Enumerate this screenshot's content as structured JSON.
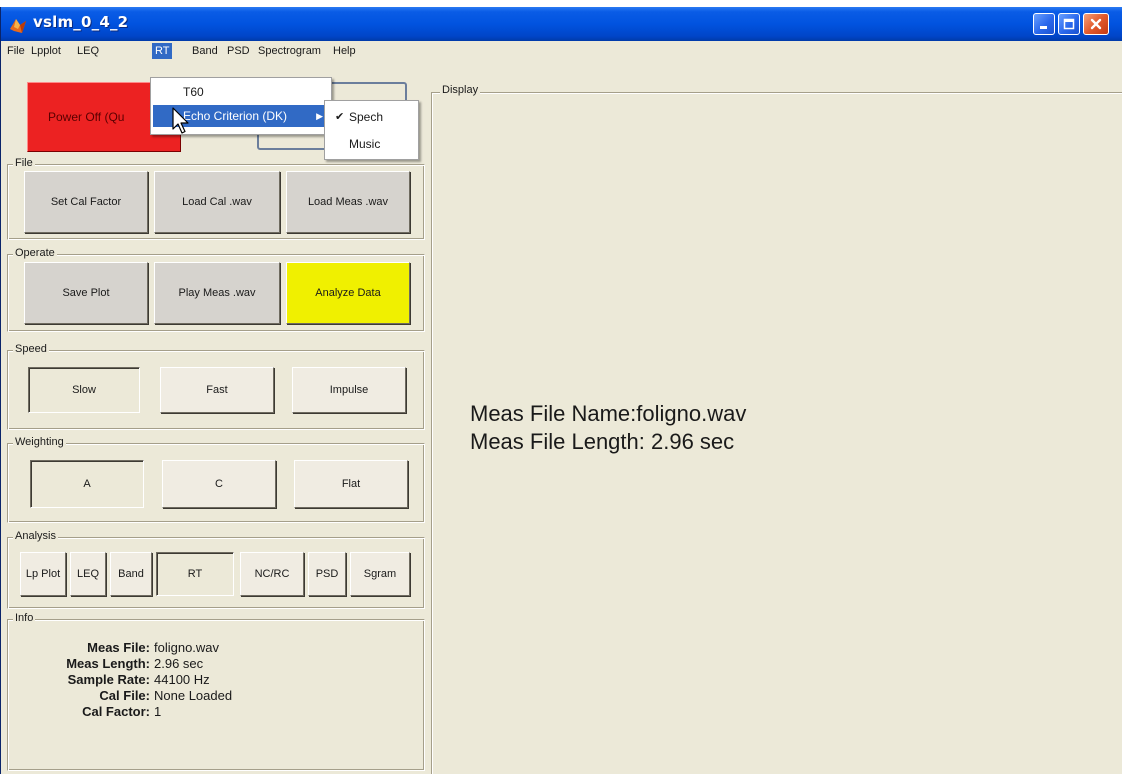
{
  "window": {
    "title": "vslm_0_4_2",
    "controls": {
      "minimize_icon": "minimize-icon",
      "maximize_icon": "maximize-icon",
      "close_icon": "close-icon"
    }
  },
  "menubar": {
    "items": [
      {
        "label": "File"
      },
      {
        "label": "Lpplot"
      },
      {
        "label": "LEQ"
      },
      {
        "label": "RT"
      },
      {
        "label": "Band"
      },
      {
        "label": "PSD"
      },
      {
        "label": "Spectrogram"
      },
      {
        "label": "Help"
      }
    ],
    "active": "RT"
  },
  "rt_menu": {
    "items": [
      {
        "label": "T60"
      },
      {
        "label": "Echo Criterion (DK)",
        "has_submenu": true
      }
    ],
    "submenu": [
      {
        "label": "Spech",
        "checked": true
      },
      {
        "label": "Music",
        "checked": false
      }
    ]
  },
  "power": {
    "label": "Power Off (Qu",
    "color": "#ec2222"
  },
  "groups": {
    "file": {
      "title": "File",
      "buttons": [
        "Set Cal Factor",
        "Load Cal .wav",
        "Load Meas .wav"
      ]
    },
    "operate": {
      "title": "Operate",
      "buttons": [
        "Save Plot",
        "Play Meas .wav",
        "Analyze Data"
      ]
    },
    "speed": {
      "title": "Speed",
      "buttons": [
        "Slow",
        "Fast",
        "Impulse"
      ],
      "selected": "Slow"
    },
    "weighting": {
      "title": "Weighting",
      "buttons": [
        "A",
        "C",
        "Flat"
      ],
      "selected": "A"
    },
    "analysis": {
      "title": "Analysis",
      "buttons": [
        "Lp Plot",
        "LEQ",
        "Band",
        "RT",
        "NC/RC",
        "PSD",
        "Sgram"
      ],
      "selected": "RT"
    },
    "info": {
      "title": "Info",
      "rows": [
        {
          "key": "Meas File:",
          "value": "foligno.wav"
        },
        {
          "key": "Meas Length:",
          "value": "2.96 sec"
        },
        {
          "key": "Sample Rate:",
          "value": "44100 Hz"
        },
        {
          "key": "Cal File:",
          "value": "None Loaded"
        },
        {
          "key": "Cal Factor:",
          "value": "1"
        }
      ]
    }
  },
  "display": {
    "title": "Display",
    "lines": [
      "Meas File Name:foligno.wav",
      "Meas File Length: 2.96 sec"
    ]
  },
  "colors": {
    "analyze_button": "#f0f000",
    "menu_highlight": "#316ac5",
    "titlebar": "#0153df"
  }
}
